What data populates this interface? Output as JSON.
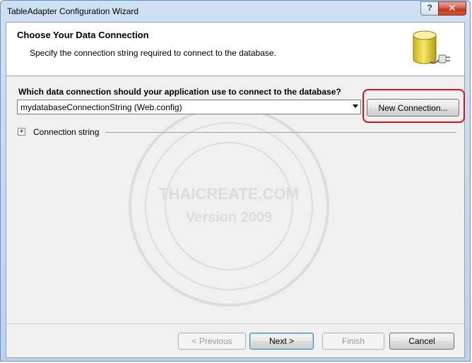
{
  "window": {
    "title": "TableAdapter Configuration Wizard"
  },
  "titlebar": {
    "help_label": "?",
    "close_label": "✕"
  },
  "header": {
    "title": "Choose Your Data Connection",
    "subtitle": "Specify the connection string required to connect to the database."
  },
  "main": {
    "question": "Which data connection should your application use to connect to the database?",
    "connection_select": {
      "selected_value": "mydatabaseConnectionString (Web.config)"
    },
    "new_connection_label": "New Connection...",
    "connection_string_toggle": "+",
    "connection_string_label": "Connection string"
  },
  "watermark": {
    "line1": "THAICREATE.COM",
    "line2": "Version 2009"
  },
  "footer": {
    "previous_label": "< Previous",
    "next_label": "Next >",
    "finish_label": "Finish",
    "cancel_label": "Cancel"
  },
  "icons": {
    "database": "database-with-plug-icon",
    "highlight_color": "#d0141b"
  }
}
